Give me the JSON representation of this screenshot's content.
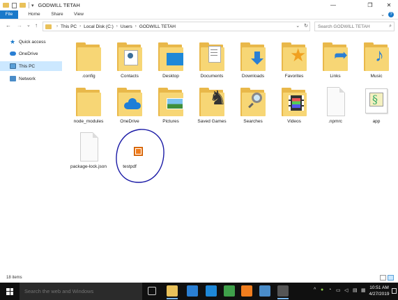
{
  "window": {
    "title": "GODWILL TETAH",
    "minimize_icon": "minimize-icon",
    "maximize_icon": "maximize-icon",
    "close_icon": "close-icon"
  },
  "ribbon": {
    "tabs": [
      "File",
      "Home",
      "Share",
      "View"
    ]
  },
  "nav": {
    "back": "←",
    "forward": "→",
    "recent": "⌄",
    "up": "↑",
    "breadcrumb": [
      "This PC",
      "Local Disk (C:)",
      "Users",
      "GODWILL TETAH"
    ],
    "search_placeholder": "Search GODWILL TETAH"
  },
  "sidebar": {
    "items": [
      {
        "label": "Quick access",
        "icon": "star-icon"
      },
      {
        "label": "OneDrive",
        "icon": "cloud-icon"
      },
      {
        "label": "This PC",
        "icon": "computer-icon",
        "selected": true
      },
      {
        "label": "Network",
        "icon": "network-icon"
      }
    ]
  },
  "files": [
    {
      "label": ".config",
      "type": "folder"
    },
    {
      "label": "Contacts",
      "type": "folder",
      "icon": "contacts-icon"
    },
    {
      "label": "Desktop",
      "type": "folder",
      "icon": "desktop-icon"
    },
    {
      "label": "Documents",
      "type": "folder",
      "icon": "documents-icon"
    },
    {
      "label": "Downloads",
      "type": "folder",
      "icon": "download-arrow-icon"
    },
    {
      "label": "Favorites",
      "type": "folder",
      "icon": "star-icon"
    },
    {
      "label": "Links",
      "type": "folder",
      "icon": "link-arrow-icon"
    },
    {
      "label": "Music",
      "type": "folder",
      "icon": "music-note-icon"
    },
    {
      "label": "node_modules",
      "type": "folder"
    },
    {
      "label": "OneDrive",
      "type": "folder",
      "icon": "cloud-icon"
    },
    {
      "label": "Pictures",
      "type": "folder",
      "icon": "picture-icon"
    },
    {
      "label": "Saved Games",
      "type": "folder",
      "icon": "chess-icon"
    },
    {
      "label": "Searches",
      "type": "folder",
      "icon": "magnifier-icon"
    },
    {
      "label": "Videos",
      "type": "folder",
      "icon": "film-icon"
    },
    {
      "label": ".npmrc",
      "type": "file"
    },
    {
      "label": "app",
      "type": "app",
      "icon": "script-icon"
    },
    {
      "label": "package-lock.json",
      "type": "file"
    },
    {
      "label": "testpdf",
      "type": "pdf",
      "icon": "pdf-icon"
    }
  ],
  "status": {
    "item_count": "18 items"
  },
  "taskbar": {
    "search_placeholder": "Search the web and Windows",
    "apps": [
      "task-view-icon",
      "file-explorer-icon",
      "store-icon",
      "mail-icon",
      "notepad-icon",
      "vlc-icon",
      "app-icon",
      "dark-app-icon"
    ],
    "time": "10:51 AM",
    "date": "4/27/2019"
  },
  "colors": {
    "accent": "#1979ca",
    "folder": "#f7d675",
    "selection": "#cce8ff",
    "annotation": "#1a1aa6"
  }
}
